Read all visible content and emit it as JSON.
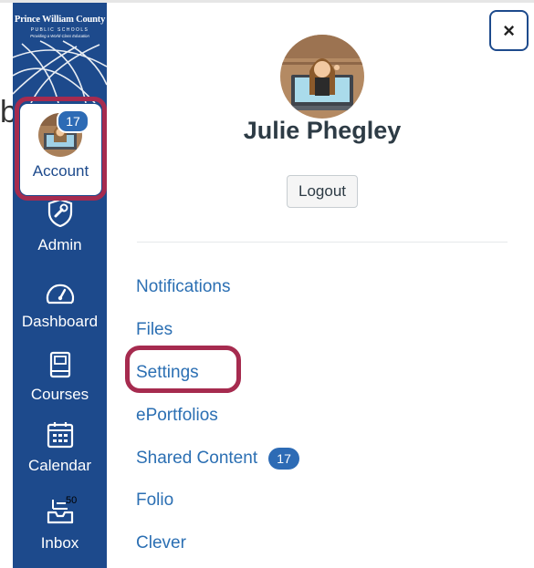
{
  "district": {
    "name": "Prince William County",
    "subtitle": "PUBLIC SCHOOLS",
    "tagline": "Providing a World-Class Education"
  },
  "nav": {
    "account": {
      "label": "Account",
      "badge": "17"
    },
    "admin": {
      "label": "Admin"
    },
    "dashboard": {
      "label": "Dashboard"
    },
    "courses": {
      "label": "Courses"
    },
    "calendar": {
      "label": "Calendar"
    },
    "inbox": {
      "label": "Inbox",
      "count": "50"
    }
  },
  "stray_text": "b",
  "tray": {
    "close_label": "×",
    "user_name": "Julie Phegley",
    "logout_label": "Logout",
    "links": [
      {
        "label": "Notifications"
      },
      {
        "label": "Files"
      },
      {
        "label": "Settings"
      },
      {
        "label": "ePortfolios"
      },
      {
        "label": "Shared Content",
        "badge": "17"
      },
      {
        "label": "Folio"
      },
      {
        "label": "Clever"
      }
    ]
  },
  "colors": {
    "nav_bg": "#1d4a8c",
    "link": "#2b6fb3",
    "highlight": "#a62b4f",
    "badge": "#2d6bb5"
  }
}
